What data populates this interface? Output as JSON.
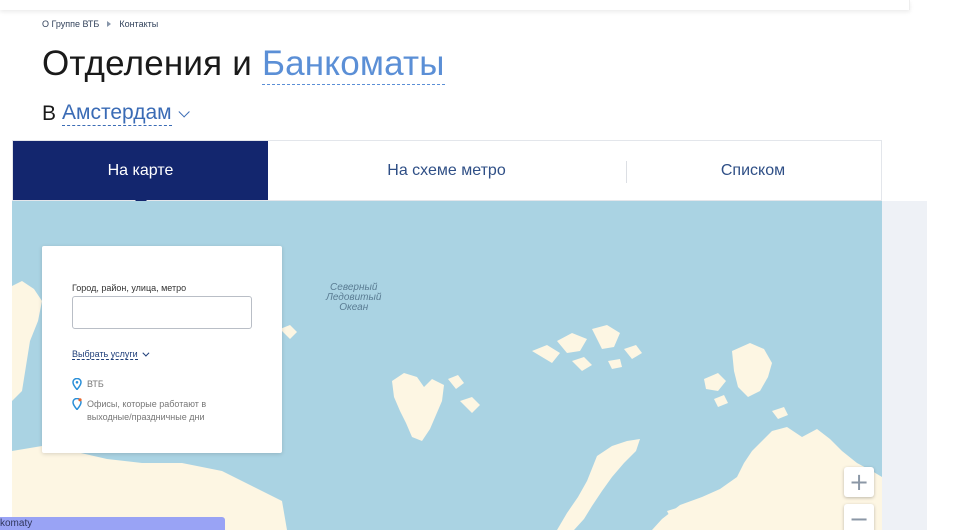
{
  "breadcrumb": {
    "item1": "О Группе ВТБ",
    "item2": "Контакты"
  },
  "title": {
    "prefix": "Отделения и ",
    "link": "Банкоматы"
  },
  "city": {
    "prefix": "В",
    "name": "Амстердам"
  },
  "tabs": [
    {
      "label": "На карте",
      "active": true
    },
    {
      "label": "На схеме метро",
      "active": false
    },
    {
      "label": "Списком",
      "active": false
    }
  ],
  "map": {
    "ocean_label_lines": [
      "Северный",
      "Ледовитый",
      "Океан"
    ],
    "water_color": "#aad3e3",
    "land_color": "#fdf6e3",
    "zoom_in_symbol": "+",
    "zoom_out_symbol": "−"
  },
  "search_panel": {
    "label": "Город, район, улица, метро",
    "input_value": "",
    "input_placeholder": "",
    "services_link": "Выбрать услуги",
    "legend": [
      {
        "icon": "map-pin-icon",
        "text": "ВТБ",
        "color": "#2a8fd8"
      },
      {
        "icon": "map-pin-clock-icon",
        "text": "Офисы, которые работают в выходные/праздничные дни",
        "color": "#2a8fd8"
      }
    ]
  },
  "status_bar": {
    "text": "komaty"
  },
  "colors": {
    "accent": "#13266e",
    "link": "#5b8fd6"
  }
}
